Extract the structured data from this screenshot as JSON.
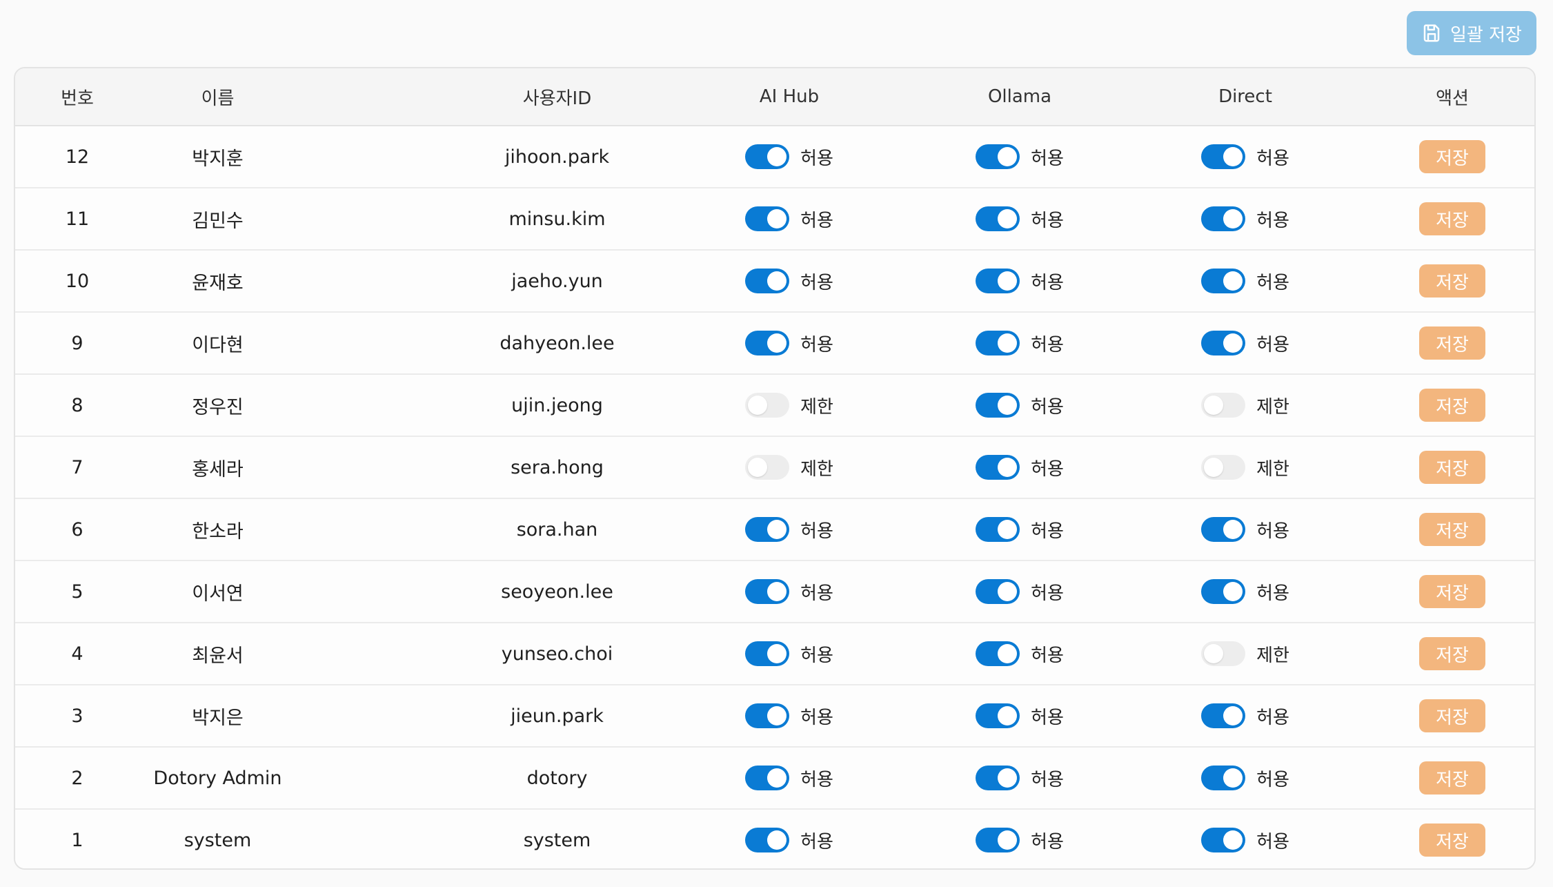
{
  "toolbar": {
    "bulk_save_label": "일괄 저장",
    "bulk_save_icon": "save-icon"
  },
  "table": {
    "headers": [
      "번호",
      "이름",
      "사용자ID",
      "AI Hub",
      "Ollama",
      "Direct",
      "액션"
    ],
    "save_label": "저장",
    "allow_label": "허용",
    "restrict_label": "제한",
    "rows": [
      {
        "no": "12",
        "name": "박지훈",
        "user_id": "jihoon.park",
        "ai_hub": "허용",
        "ollama": "허용",
        "direct": "허용",
        "action": "저장"
      },
      {
        "no": "11",
        "name": "김민수",
        "user_id": "minsu.kim",
        "ai_hub": "허용",
        "ollama": "허용",
        "direct": "허용",
        "action": "저장"
      },
      {
        "no": "10",
        "name": "윤재호",
        "user_id": "jaeho.yun",
        "ai_hub": "허용",
        "ollama": "허용",
        "direct": "허용",
        "action": "저장"
      },
      {
        "no": "9",
        "name": "이다현",
        "user_id": "dahyeon.lee",
        "ai_hub": "허용",
        "ollama": "허용",
        "direct": "허용",
        "action": "저장"
      },
      {
        "no": "8",
        "name": "정우진",
        "user_id": "ujin.jeong",
        "ai_hub": "제한",
        "ollama": "허용",
        "direct": "제한",
        "action": "저장"
      },
      {
        "no": "7",
        "name": "홍세라",
        "user_id": "sera.hong",
        "ai_hub": "제한",
        "ollama": "허용",
        "direct": "제한",
        "action": "저장"
      },
      {
        "no": "6",
        "name": "한소라",
        "user_id": "sora.han",
        "ai_hub": "허용",
        "ollama": "허용",
        "direct": "허용",
        "action": "저장"
      },
      {
        "no": "5",
        "name": "이서연",
        "user_id": "seoyeon.lee",
        "ai_hub": "허용",
        "ollama": "허용",
        "direct": "허용",
        "action": "저장"
      },
      {
        "no": "4",
        "name": "최윤서",
        "user_id": "yunseo.choi",
        "ai_hub": "허용",
        "ollama": "허용",
        "direct": "제한",
        "action": "저장"
      },
      {
        "no": "3",
        "name": "박지은",
        "user_id": "jieun.park",
        "ai_hub": "허용",
        "ollama": "허용",
        "direct": "허용",
        "action": "저장"
      },
      {
        "no": "2",
        "name": "Dotory Admin",
        "user_id": "dotory",
        "ai_hub": "허용",
        "ollama": "허용",
        "direct": "허용",
        "action": "저장"
      },
      {
        "no": "1",
        "name": "system",
        "user_id": "system",
        "ai_hub": "허용",
        "ollama": "허용",
        "direct": "허용",
        "action": "저장"
      }
    ]
  },
  "colors": {
    "toggle_on": "#0a7bd4",
    "toggle_off": "#ededed",
    "save_button": "#f3b67e",
    "bulk_save_button": "#8cc3e6"
  }
}
